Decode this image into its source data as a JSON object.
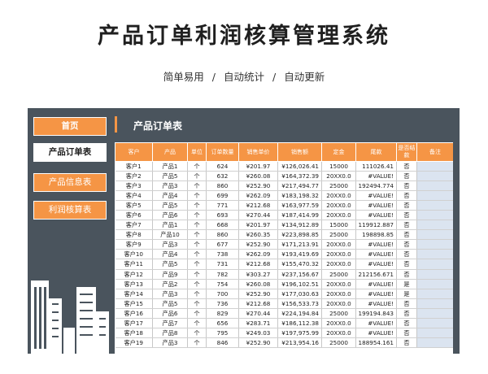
{
  "header": {
    "title": "产品订单利润核算管理系统",
    "subtitle_items": [
      "简单易用",
      "自动统计",
      "自动更新"
    ],
    "subtitle_sep": "/"
  },
  "sidebar": {
    "home_label": "首页",
    "items": [
      {
        "label": "产品订单表"
      },
      {
        "label": "产品信息表"
      },
      {
        "label": "利润核算表"
      }
    ]
  },
  "main": {
    "page_title": "产品订单表",
    "columns": [
      "客户",
      "产品",
      "单位",
      "订单数量",
      "销售单价",
      "销售额",
      "定金",
      "尾款",
      "是否结款",
      "备注"
    ],
    "rows": [
      [
        "客户1",
        "产品1",
        "个",
        "624",
        "¥201.97",
        "¥126,026.41",
        "15000",
        "111026.41",
        "否",
        ""
      ],
      [
        "客户2",
        "产品5",
        "个",
        "632",
        "¥260.08",
        "¥164,372.39",
        "20XX0.0",
        "#VALUE!",
        "否",
        ""
      ],
      [
        "客户3",
        "产品3",
        "个",
        "860",
        "¥252.90",
        "¥217,494.77",
        "25000",
        "192494.774",
        "否",
        ""
      ],
      [
        "客户4",
        "产品4",
        "个",
        "699",
        "¥262.09",
        "¥183,198.32",
        "20XX0.0",
        "#VALUE!",
        "否",
        ""
      ],
      [
        "客户5",
        "产品5",
        "个",
        "771",
        "¥212.68",
        "¥163,977.59",
        "20XX0.0",
        "#VALUE!",
        "否",
        ""
      ],
      [
        "客户6",
        "产品6",
        "个",
        "693",
        "¥270.44",
        "¥187,414.99",
        "20XX0.0",
        "#VALUE!",
        "否",
        ""
      ],
      [
        "客户7",
        "产品1",
        "个",
        "668",
        "¥201.97",
        "¥134,912.89",
        "15000",
        "119912.887",
        "否",
        ""
      ],
      [
        "客户8",
        "产品10",
        "个",
        "860",
        "¥260.35",
        "¥223,898.85",
        "25000",
        "198898.85",
        "否",
        ""
      ],
      [
        "客户9",
        "产品3",
        "个",
        "677",
        "¥252.90",
        "¥171,213.91",
        "20XX0.0",
        "#VALUE!",
        "否",
        ""
      ],
      [
        "客户10",
        "产品4",
        "个",
        "738",
        "¥262.09",
        "¥193,419.69",
        "20XX0.0",
        "#VALUE!",
        "否",
        ""
      ],
      [
        "客户11",
        "产品5",
        "个",
        "731",
        "¥212.68",
        "¥155,470.32",
        "20XX0.0",
        "#VALUE!",
        "否",
        ""
      ],
      [
        "客户12",
        "产品9",
        "个",
        "782",
        "¥303.27",
        "¥237,156.67",
        "25000",
        "212156.671",
        "否",
        ""
      ],
      [
        "客户13",
        "产品2",
        "个",
        "754",
        "¥260.08",
        "¥196,102.51",
        "20XX0.0",
        "#VALUE!",
        "是",
        ""
      ],
      [
        "客户14",
        "产品3",
        "个",
        "700",
        "¥252.90",
        "¥177,030.63",
        "20XX0.0",
        "#VALUE!",
        "是",
        ""
      ],
      [
        "客户15",
        "产品5",
        "个",
        "736",
        "¥212.68",
        "¥156,533.73",
        "20XX0.0",
        "#VALUE!",
        "否",
        ""
      ],
      [
        "客户16",
        "产品6",
        "个",
        "829",
        "¥270.44",
        "¥224,194.84",
        "25000",
        "199194.843",
        "否",
        ""
      ],
      [
        "客户17",
        "产品7",
        "个",
        "656",
        "¥283.71",
        "¥186,112.38",
        "20XX0.0",
        "#VALUE!",
        "否",
        ""
      ],
      [
        "客户18",
        "产品8",
        "个",
        "795",
        "¥249.03",
        "¥197,975.99",
        "20XX0.0",
        "#VALUE!",
        "否",
        ""
      ],
      [
        "客户19",
        "产品3",
        "个",
        "846",
        "¥252.90",
        "¥213,954.16",
        "25000",
        "188954.161",
        "否",
        ""
      ]
    ]
  },
  "colors": {
    "accent": "#f59545",
    "panel": "#4a545d",
    "note_cell": "#dbe4f0"
  }
}
